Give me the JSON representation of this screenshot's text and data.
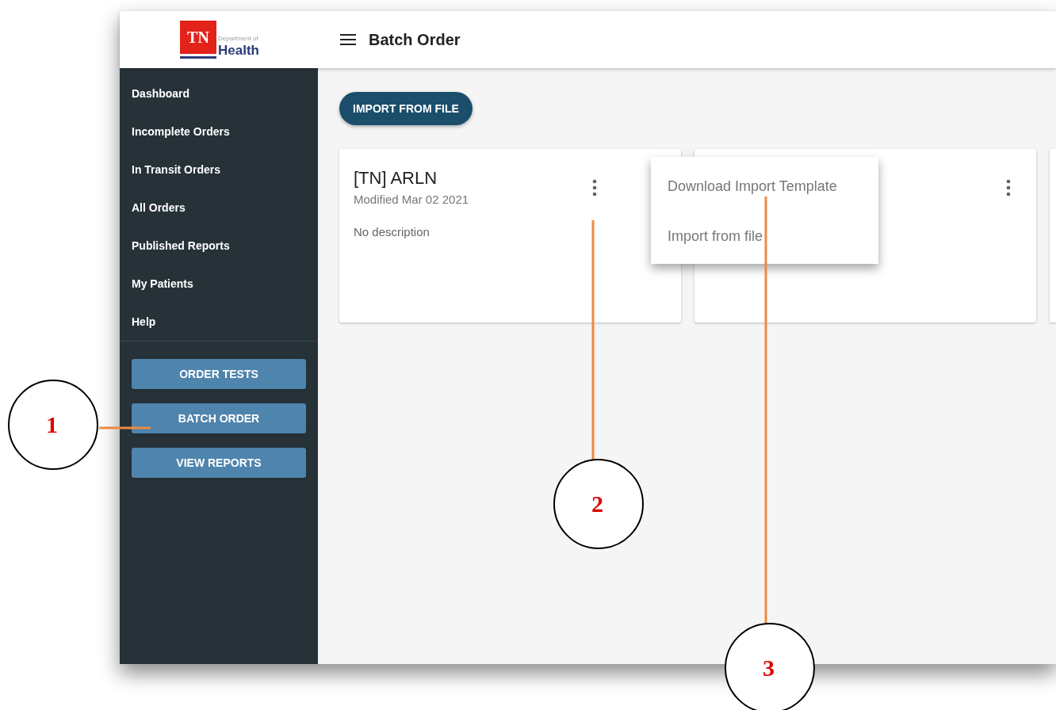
{
  "logo": {
    "mark": "TN",
    "line_1": "Department of",
    "line_2": "Health"
  },
  "header": {
    "title": "Batch Order"
  },
  "sidebar": {
    "items": [
      {
        "label": "Dashboard"
      },
      {
        "label": "Incomplete Orders"
      },
      {
        "label": "In Transit Orders"
      },
      {
        "label": "All Orders"
      },
      {
        "label": "Published Reports"
      },
      {
        "label": "My Patients"
      },
      {
        "label": "Help"
      }
    ],
    "buttons": [
      {
        "label": "ORDER TESTS"
      },
      {
        "label": "BATCH ORDER"
      },
      {
        "label": "VIEW REPORTS"
      }
    ]
  },
  "main": {
    "import_button": "IMPORT FROM FILE",
    "cards": [
      {
        "kind": "detail",
        "title": "[TN] ARLN",
        "modified": "Modified Mar 02 2021",
        "description": "No description"
      },
      {
        "kind": "blank"
      }
    ],
    "menu": {
      "items": [
        {
          "label": "Download Import Template"
        },
        {
          "label": "Import from file"
        }
      ]
    }
  },
  "callouts": [
    {
      "label": "1"
    },
    {
      "label": "2"
    },
    {
      "label": "3"
    }
  ]
}
